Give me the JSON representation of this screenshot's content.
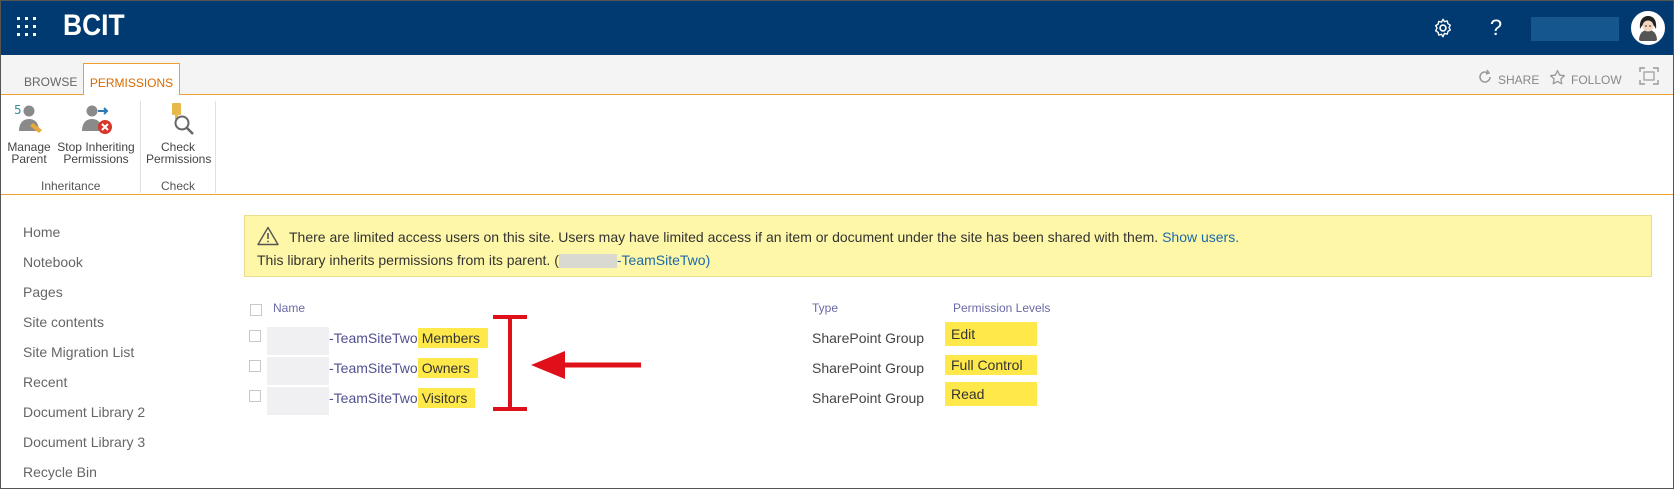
{
  "suitebar": {
    "brand": "BCIT",
    "icons": [
      "app-launcher-icon",
      "gear-icon",
      "help-icon",
      "avatar"
    ],
    "help_glyph": "?",
    "accent": "#003a70"
  },
  "tabs": {
    "browse": "BROWSE",
    "permissions": "PERMISSIONS",
    "share": "SHARE",
    "follow": "FOLLOW"
  },
  "ribbon": {
    "manage_parent": [
      "Manage",
      "Parent"
    ],
    "stop_inheriting": [
      "Stop Inheriting",
      "Permissions"
    ],
    "check_permissions": [
      "Check",
      "Permissions"
    ],
    "group_inheritance": "Inheritance",
    "group_check": "Check"
  },
  "leftnav": {
    "items": [
      "Home",
      "Notebook",
      "Pages",
      "Site contents",
      "Site Migration List",
      "Recent",
      "Document Library 2",
      "Document Library 3",
      "Recycle Bin"
    ]
  },
  "notice": {
    "line1": "There are limited access users on this site. Users may have limited access if an item or document under the site has been shared with them.",
    "show_users": "Show users.",
    "line2_prefix": "This library inherits permissions from its parent. (",
    "line2_link": "-TeamSiteTwo",
    "line2_suffix": ")"
  },
  "list": {
    "headers": {
      "name": "Name",
      "type": "Type",
      "levels": "Permission Levels"
    },
    "rows": [
      {
        "name": "-TeamSiteTwo",
        "suffix": "Members",
        "type": "SharePoint Group",
        "level": "Edit"
      },
      {
        "name": "-TeamSiteTwo",
        "suffix": "Owners",
        "type": "SharePoint Group",
        "level": "Full Control"
      },
      {
        "name": "-TeamSiteTwo",
        "suffix": "Visitors",
        "type": "SharePoint Group",
        "level": "Read"
      }
    ]
  },
  "annotation": {
    "color": "#e0101a"
  },
  "highlight_color": "#ffe94a"
}
